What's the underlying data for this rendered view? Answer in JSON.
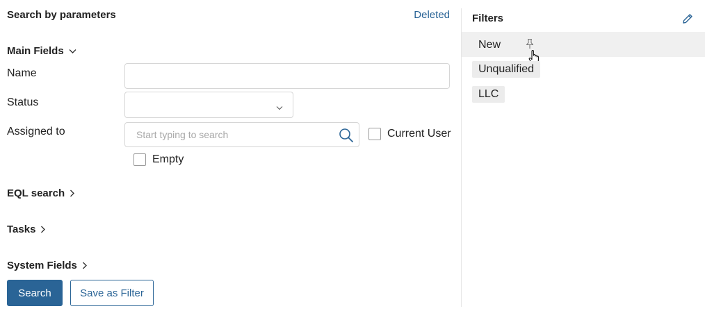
{
  "header": {
    "title": "Search by parameters",
    "deleted_link": "Deleted"
  },
  "sections": {
    "main_fields": "Main Fields",
    "eql_search": "EQL search",
    "tasks": "Tasks",
    "system_fields": "System Fields"
  },
  "fields": {
    "name": {
      "label": "Name",
      "value": ""
    },
    "status": {
      "label": "Status",
      "value": ""
    },
    "assigned_to": {
      "label": "Assigned to",
      "placeholder": "Start typing to search"
    }
  },
  "checkboxes": {
    "current_user": "Current User",
    "empty": "Empty"
  },
  "buttons": {
    "search": "Search",
    "save_as_filter": "Save as Filter"
  },
  "filters": {
    "title": "Filters",
    "items": [
      {
        "label": "New"
      },
      {
        "label": "Unqualified"
      },
      {
        "label": "LLC"
      }
    ]
  },
  "colors": {
    "accent": "#2a6496",
    "selected_row": "#f0f0f0",
    "chip_bg": "#ececec"
  },
  "icons": [
    "chevron-down-icon",
    "chevron-right-icon",
    "search-icon",
    "pencil-icon",
    "pin-icon",
    "hand-cursor-icon"
  ]
}
